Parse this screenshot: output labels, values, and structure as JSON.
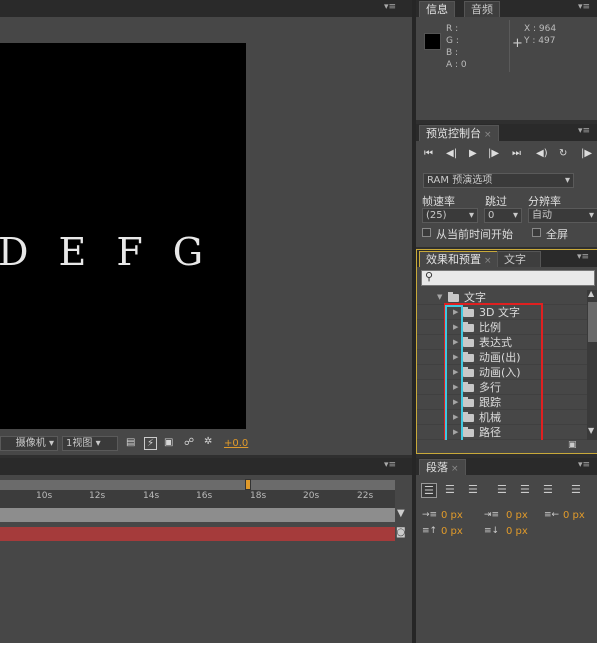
{
  "composition": {
    "canvas_text": "D E F G",
    "toolbar": {
      "camera_select": "摄像机",
      "view_select": "1视图",
      "exposure_value": "+0.0"
    }
  },
  "info_panel": {
    "tabs": [
      "信息",
      "音频"
    ],
    "r_label": "R :",
    "g_label": "G :",
    "b_label": "B :",
    "a_label": "A : 0",
    "x_label": "X : 964",
    "y_label": "Y : 497"
  },
  "preview_panel": {
    "tab": "预览控制台",
    "ram_select": "RAM 预演选项",
    "frame_rate_label": "帧速率",
    "skip_label": "跳过",
    "resolution_label": "分辨率",
    "frame_rate_value": "(25)",
    "skip_value": "0",
    "resolution_value": "自动",
    "from_current_label": "从当前时间开始",
    "fullscreen_label": "全屏"
  },
  "effects_panel": {
    "tabs": [
      "效果和预置",
      "文字"
    ],
    "search_placeholder": "",
    "root_folder": "文字",
    "items": [
      "3D 文字",
      "比例",
      "表达式",
      "动画(出)",
      "动画(入)",
      "多行",
      "跟踪",
      "机械",
      "路径"
    ]
  },
  "timeline": {
    "ticks": [
      "10s",
      "12s",
      "14s",
      "16s",
      "18s",
      "20s",
      "22s"
    ]
  },
  "paragraph_panel": {
    "tab": "段落",
    "indent_left": "0 px",
    "indent_first": "0 px",
    "indent_right": "0 px",
    "space_before": "0 px",
    "space_after": "0 px"
  },
  "colors": {
    "highlight_red": "#e02020",
    "highlight_cyan": "#3fc8e0",
    "timeline_red_bar": "#a53b3b",
    "accent_orange": "#e09a2a"
  }
}
